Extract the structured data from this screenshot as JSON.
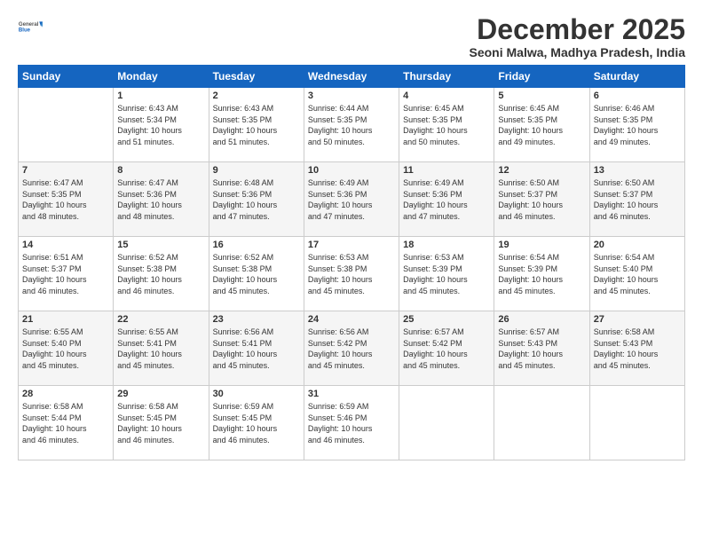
{
  "header": {
    "logo_general": "General",
    "logo_blue": "Blue",
    "month_title": "December 2025",
    "location": "Seoni Malwa, Madhya Pradesh, India"
  },
  "weekdays": [
    "Sunday",
    "Monday",
    "Tuesday",
    "Wednesday",
    "Thursday",
    "Friday",
    "Saturday"
  ],
  "weeks": [
    [
      {
        "day": "",
        "info": ""
      },
      {
        "day": "1",
        "info": "Sunrise: 6:43 AM\nSunset: 5:34 PM\nDaylight: 10 hours\nand 51 minutes."
      },
      {
        "day": "2",
        "info": "Sunrise: 6:43 AM\nSunset: 5:35 PM\nDaylight: 10 hours\nand 51 minutes."
      },
      {
        "day": "3",
        "info": "Sunrise: 6:44 AM\nSunset: 5:35 PM\nDaylight: 10 hours\nand 50 minutes."
      },
      {
        "day": "4",
        "info": "Sunrise: 6:45 AM\nSunset: 5:35 PM\nDaylight: 10 hours\nand 50 minutes."
      },
      {
        "day": "5",
        "info": "Sunrise: 6:45 AM\nSunset: 5:35 PM\nDaylight: 10 hours\nand 49 minutes."
      },
      {
        "day": "6",
        "info": "Sunrise: 6:46 AM\nSunset: 5:35 PM\nDaylight: 10 hours\nand 49 minutes."
      }
    ],
    [
      {
        "day": "7",
        "info": "Sunrise: 6:47 AM\nSunset: 5:35 PM\nDaylight: 10 hours\nand 48 minutes."
      },
      {
        "day": "8",
        "info": "Sunrise: 6:47 AM\nSunset: 5:36 PM\nDaylight: 10 hours\nand 48 minutes."
      },
      {
        "day": "9",
        "info": "Sunrise: 6:48 AM\nSunset: 5:36 PM\nDaylight: 10 hours\nand 47 minutes."
      },
      {
        "day": "10",
        "info": "Sunrise: 6:49 AM\nSunset: 5:36 PM\nDaylight: 10 hours\nand 47 minutes."
      },
      {
        "day": "11",
        "info": "Sunrise: 6:49 AM\nSunset: 5:36 PM\nDaylight: 10 hours\nand 47 minutes."
      },
      {
        "day": "12",
        "info": "Sunrise: 6:50 AM\nSunset: 5:37 PM\nDaylight: 10 hours\nand 46 minutes."
      },
      {
        "day": "13",
        "info": "Sunrise: 6:50 AM\nSunset: 5:37 PM\nDaylight: 10 hours\nand 46 minutes."
      }
    ],
    [
      {
        "day": "14",
        "info": "Sunrise: 6:51 AM\nSunset: 5:37 PM\nDaylight: 10 hours\nand 46 minutes."
      },
      {
        "day": "15",
        "info": "Sunrise: 6:52 AM\nSunset: 5:38 PM\nDaylight: 10 hours\nand 46 minutes."
      },
      {
        "day": "16",
        "info": "Sunrise: 6:52 AM\nSunset: 5:38 PM\nDaylight: 10 hours\nand 45 minutes."
      },
      {
        "day": "17",
        "info": "Sunrise: 6:53 AM\nSunset: 5:38 PM\nDaylight: 10 hours\nand 45 minutes."
      },
      {
        "day": "18",
        "info": "Sunrise: 6:53 AM\nSunset: 5:39 PM\nDaylight: 10 hours\nand 45 minutes."
      },
      {
        "day": "19",
        "info": "Sunrise: 6:54 AM\nSunset: 5:39 PM\nDaylight: 10 hours\nand 45 minutes."
      },
      {
        "day": "20",
        "info": "Sunrise: 6:54 AM\nSunset: 5:40 PM\nDaylight: 10 hours\nand 45 minutes."
      }
    ],
    [
      {
        "day": "21",
        "info": "Sunrise: 6:55 AM\nSunset: 5:40 PM\nDaylight: 10 hours\nand 45 minutes."
      },
      {
        "day": "22",
        "info": "Sunrise: 6:55 AM\nSunset: 5:41 PM\nDaylight: 10 hours\nand 45 minutes."
      },
      {
        "day": "23",
        "info": "Sunrise: 6:56 AM\nSunset: 5:41 PM\nDaylight: 10 hours\nand 45 minutes."
      },
      {
        "day": "24",
        "info": "Sunrise: 6:56 AM\nSunset: 5:42 PM\nDaylight: 10 hours\nand 45 minutes."
      },
      {
        "day": "25",
        "info": "Sunrise: 6:57 AM\nSunset: 5:42 PM\nDaylight: 10 hours\nand 45 minutes."
      },
      {
        "day": "26",
        "info": "Sunrise: 6:57 AM\nSunset: 5:43 PM\nDaylight: 10 hours\nand 45 minutes."
      },
      {
        "day": "27",
        "info": "Sunrise: 6:58 AM\nSunset: 5:43 PM\nDaylight: 10 hours\nand 45 minutes."
      }
    ],
    [
      {
        "day": "28",
        "info": "Sunrise: 6:58 AM\nSunset: 5:44 PM\nDaylight: 10 hours\nand 46 minutes."
      },
      {
        "day": "29",
        "info": "Sunrise: 6:58 AM\nSunset: 5:45 PM\nDaylight: 10 hours\nand 46 minutes."
      },
      {
        "day": "30",
        "info": "Sunrise: 6:59 AM\nSunset: 5:45 PM\nDaylight: 10 hours\nand 46 minutes."
      },
      {
        "day": "31",
        "info": "Sunrise: 6:59 AM\nSunset: 5:46 PM\nDaylight: 10 hours\nand 46 minutes."
      },
      {
        "day": "",
        "info": ""
      },
      {
        "day": "",
        "info": ""
      },
      {
        "day": "",
        "info": ""
      }
    ]
  ]
}
